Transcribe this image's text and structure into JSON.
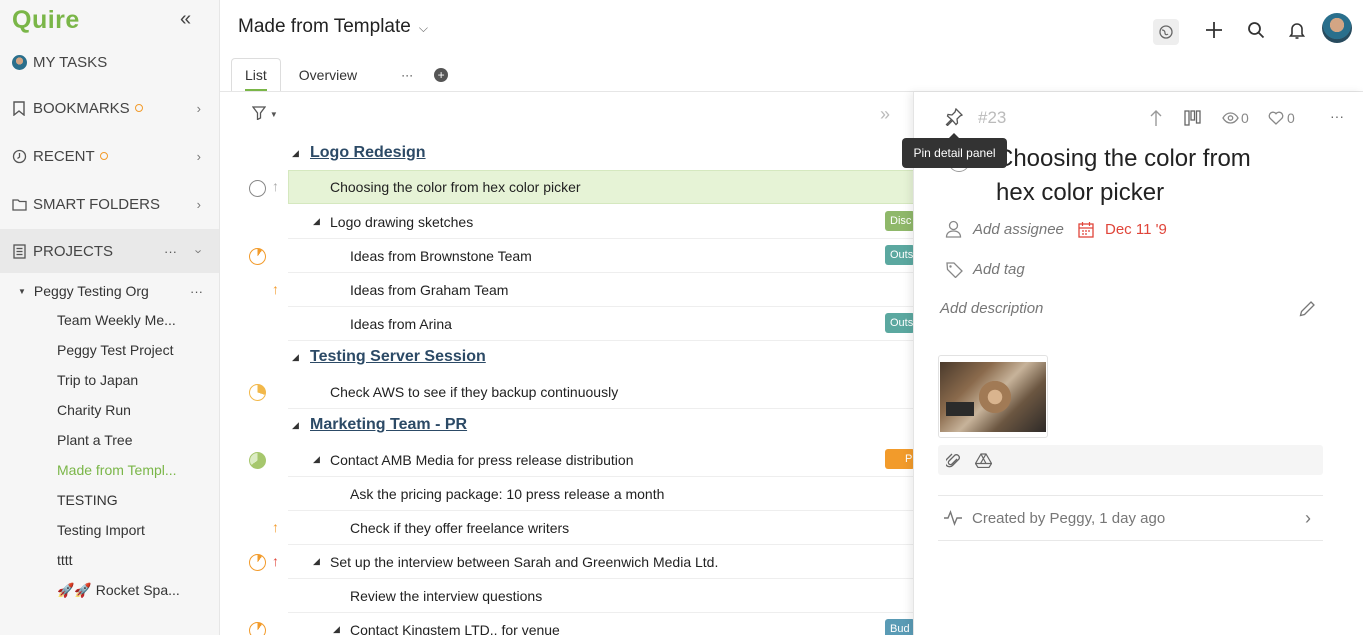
{
  "app": {
    "logo": "Quire"
  },
  "sidebar": {
    "collapse_icon": "double-chevron-left-icon",
    "my_tasks": "MY TASKS",
    "bookmarks": "BOOKMARKS",
    "recent": "RECENT",
    "smart_folders": "SMART FOLDERS",
    "projects": "PROJECTS",
    "projects_more": "···",
    "org": "Peggy Testing Org",
    "org_more": "···",
    "project_items": [
      "Team Weekly Me...",
      "Peggy Test Project",
      "Trip to Japan",
      "Charity Run",
      "Plant a Tree",
      "Made from Templ...",
      "TESTING",
      "Testing Import",
      "tttt",
      "🚀🚀 Rocket Spa..."
    ],
    "active_project": "Made from Templ..."
  },
  "header": {
    "title": "Made from Template",
    "tabs": [
      "List",
      "Overview"
    ],
    "active_tab": "List",
    "more": "···"
  },
  "tasks": {
    "groups": [
      "Logo Redesign",
      "Testing Server Session",
      "Marketing Team - PR"
    ],
    "rows": [
      "Choosing the color from hex color picker",
      "Logo drawing sketches",
      "Ideas from Brownstone Team",
      "Ideas from Graham Team",
      "Ideas from Arina",
      "Check AWS to see if they backup continuously",
      "Contact AMB Media for press release distribution",
      "Ask the pricing package: 10 press release a month",
      "Check if they offer freelance writers",
      "Set up the interview between Sarah and Greenwich Media Ltd.",
      "Review the interview questions",
      "Contact Kingstem LTD.. for venue"
    ],
    "tags": [
      "Disc",
      "Outs",
      "Outs",
      "P",
      "Bud"
    ],
    "tag_colors": {
      "green": "#8fb86a",
      "teal": "#5ba8a0",
      "orange": "#f29b2b",
      "blue": "#5a9bb5"
    }
  },
  "panel": {
    "task_id": "#23",
    "tooltip": "Pin detail panel",
    "watchers": "0",
    "likes": "0",
    "more": "···",
    "title": "Choosing the color from hex color picker",
    "assignee_placeholder": "Add assignee",
    "due_date": "Dec 11 '9",
    "tag_placeholder": "Add tag",
    "description_placeholder": "Add description",
    "activity": "Created by Peggy, 1 day ago"
  },
  "colors": {
    "brand": "#7ab648",
    "due": "#e0453a",
    "group_link": "#2c4a66"
  }
}
